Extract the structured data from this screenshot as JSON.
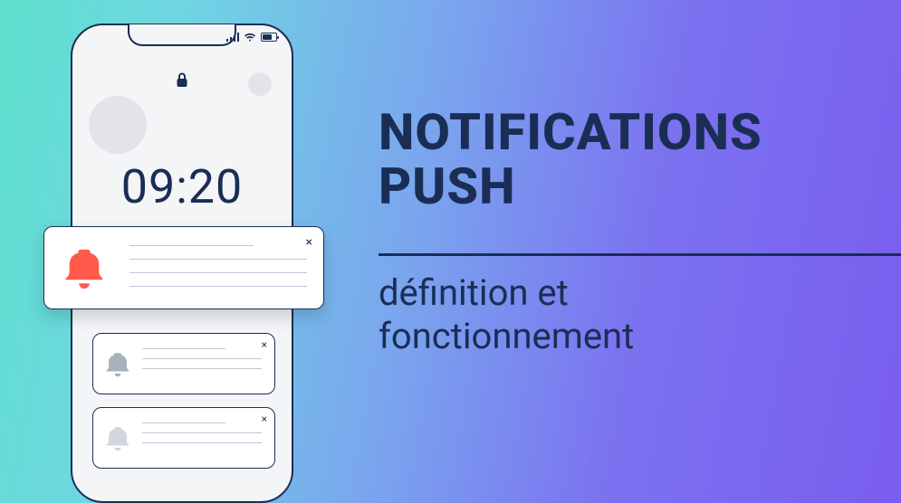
{
  "headline_line1": "NOTIFICATIONS",
  "headline_line2": "PUSH",
  "subhead_line1": "définition et",
  "subhead_line2": "fonctionnement",
  "clock": "09:20",
  "close_glyph": "×",
  "colors": {
    "ink": "#1a2e55",
    "bell_primary": "#ff5a4a",
    "bell_secondary": "#A9B0BE",
    "bell_tertiary": "#D2D6DF"
  }
}
